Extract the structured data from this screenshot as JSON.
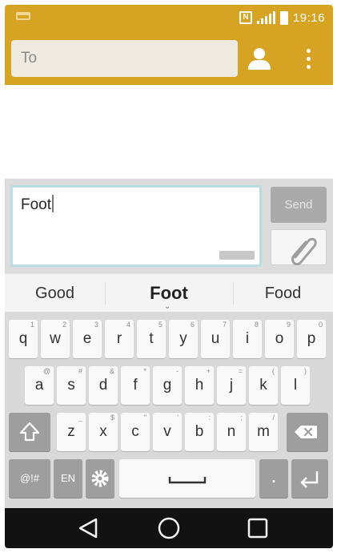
{
  "status_bar": {
    "nfc_label": "N",
    "time": "19:16"
  },
  "header": {
    "to_placeholder": "To",
    "contact_icon": "person-icon",
    "more_icon": "more-vert-icon",
    "accent_color": "#d7a322"
  },
  "compose": {
    "message_text": "Foot",
    "send_label": "Send",
    "attach_icon": "paperclip-icon"
  },
  "suggestions": [
    "Good",
    "Foot",
    "Food"
  ],
  "keyboard": {
    "row1": [
      {
        "label": "q",
        "hint": "1"
      },
      {
        "label": "w",
        "hint": "2"
      },
      {
        "label": "e",
        "hint": "3"
      },
      {
        "label": "r",
        "hint": "4"
      },
      {
        "label": "t",
        "hint": "5"
      },
      {
        "label": "y",
        "hint": "6"
      },
      {
        "label": "u",
        "hint": "7"
      },
      {
        "label": "i",
        "hint": "8"
      },
      {
        "label": "o",
        "hint": "9"
      },
      {
        "label": "p",
        "hint": "0"
      }
    ],
    "row2": [
      {
        "label": "a",
        "hint": "@"
      },
      {
        "label": "s",
        "hint": "#"
      },
      {
        "label": "d",
        "hint": "&"
      },
      {
        "label": "f",
        "hint": "*"
      },
      {
        "label": "g",
        "hint": "-"
      },
      {
        "label": "h",
        "hint": "+"
      },
      {
        "label": "j",
        "hint": "="
      },
      {
        "label": "k",
        "hint": "("
      },
      {
        "label": "l",
        "hint": ")"
      }
    ],
    "row3": [
      {
        "label": "z",
        "hint": "_"
      },
      {
        "label": "x",
        "hint": "$"
      },
      {
        "label": "c",
        "hint": "\""
      },
      {
        "label": "v",
        "hint": "'"
      },
      {
        "label": "b",
        "hint": ":"
      },
      {
        "label": "n",
        "hint": ";"
      },
      {
        "label": "m",
        "hint": "/"
      }
    ],
    "symbols_label": "@!#",
    "language_label": "EN",
    "shift_icon": "shift-icon",
    "backspace_icon": "backspace-icon",
    "settings_icon": "gear-icon",
    "space_icon": "space-icon",
    "period_label": ".",
    "enter_icon": "enter-icon"
  },
  "nav": {
    "back_icon": "back-icon",
    "home_icon": "home-icon",
    "recents_icon": "recents-icon"
  }
}
